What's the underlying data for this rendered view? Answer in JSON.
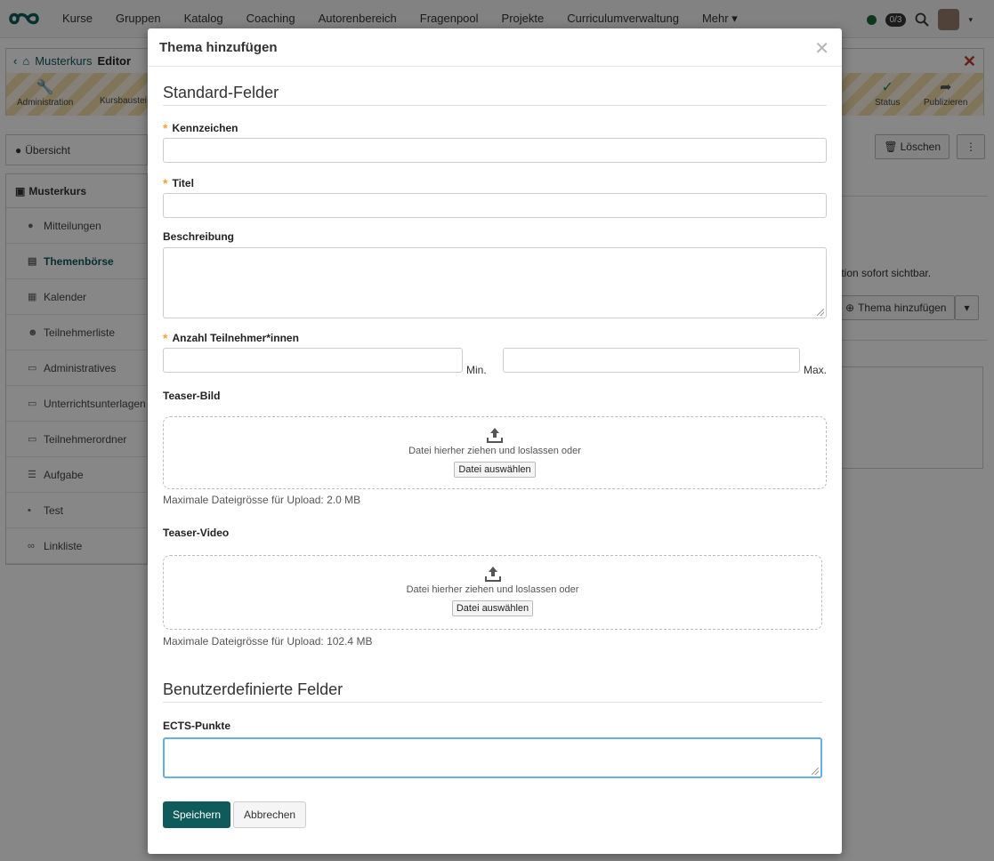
{
  "app": {
    "nav": [
      "Kurse",
      "Gruppen",
      "Katalog",
      "Coaching",
      "Autorenbereich",
      "Fragenpool",
      "Projekte",
      "Curriculumverwaltung",
      "Mehr ▾"
    ],
    "counter": "0/3"
  },
  "toolbar": {
    "breadcrumb": [
      "Musterkurs",
      "Editor"
    ],
    "tools": [
      "Administration",
      "Kursbaustei",
      "Status",
      "Publizieren"
    ]
  },
  "sidebar": {
    "overview": "Übersicht",
    "course": "Musterkurs",
    "items": [
      {
        "label": "Mitteilungen",
        "icon": "info-icon"
      },
      {
        "label": "Themenbörse",
        "icon": "clipboard-icon"
      },
      {
        "label": "Kalender",
        "icon": "calendar-icon"
      },
      {
        "label": "Teilnehmerliste",
        "icon": "users-icon"
      },
      {
        "label": "Administratives",
        "icon": "folder-icon"
      },
      {
        "label": "Unterrichtsunterlagen",
        "icon": "folder-icon"
      },
      {
        "label": "Teilnehmerordner",
        "icon": "inbox-icon"
      },
      {
        "label": "Aufgabe",
        "icon": "task-icon"
      },
      {
        "label": "Test",
        "icon": "edit-icon"
      },
      {
        "label": "Linkliste",
        "icon": "link-icon"
      }
    ]
  },
  "content": {
    "delete_label": "Löschen",
    "partial_text": "ikation sofort sichtbar.",
    "add_topic_label": "Thema hinzufügen"
  },
  "modal": {
    "title": "Thema hinzufügen",
    "section_standard": "Standard-Felder",
    "field_kennzeichen": "Kennzeichen",
    "field_titel": "Titel",
    "field_beschreibung": "Beschreibung",
    "field_anzahl": "Anzahl Teilnehmer*innen",
    "min_label": "Min.",
    "max_label": "Max.",
    "teaser_bild": "Teaser-Bild",
    "teaser_video": "Teaser-Video",
    "drop_text": "Datei hierher ziehen und loslassen oder",
    "choose_file": "Datei auswählen",
    "max_size_image": "Maximale Dateigrösse für Upload: 2.0 MB",
    "max_size_video": "Maximale Dateigrösse für Upload: 102.4 MB",
    "section_custom": "Benutzerdefinierte Felder",
    "field_ects": "ECTS-Punkte",
    "save_label": "Speichern",
    "cancel_label": "Abbrechen"
  },
  "colors": {
    "primary": "#0f5b5c",
    "required": "#f0a33a",
    "focus": "#66afe9"
  }
}
